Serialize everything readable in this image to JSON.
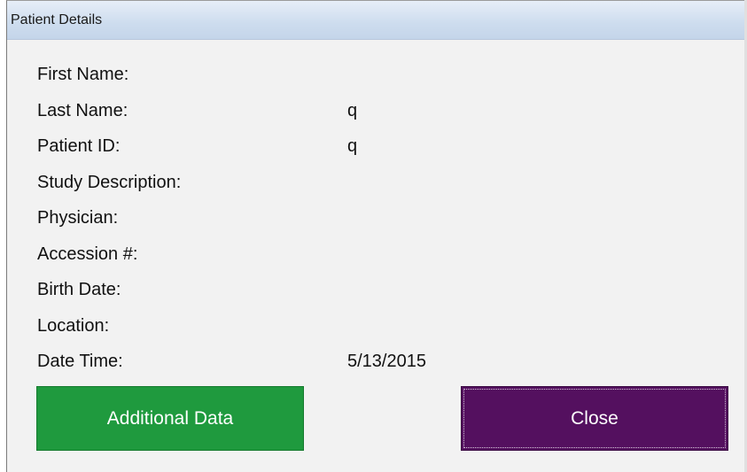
{
  "window": {
    "title": "Patient Details"
  },
  "fields": [
    {
      "label": "First Name:",
      "value": ""
    },
    {
      "label": "Last Name:",
      "value": "q"
    },
    {
      "label": "Patient ID:",
      "value": "q"
    },
    {
      "label": "Study Description:",
      "value": ""
    },
    {
      "label": "Physician:",
      "value": ""
    },
    {
      "label": "Accession #:",
      "value": ""
    },
    {
      "label": "Birth Date:",
      "value": ""
    },
    {
      "label": "Location:",
      "value": ""
    },
    {
      "label": "Date Time:",
      "value": "5/13/2015"
    }
  ],
  "buttons": {
    "additional_label": "Additional Data",
    "close_label": "Close"
  },
  "colors": {
    "additional_button": "#1f9a3e",
    "close_button": "#54105f",
    "titlebar": "#cddcee"
  }
}
